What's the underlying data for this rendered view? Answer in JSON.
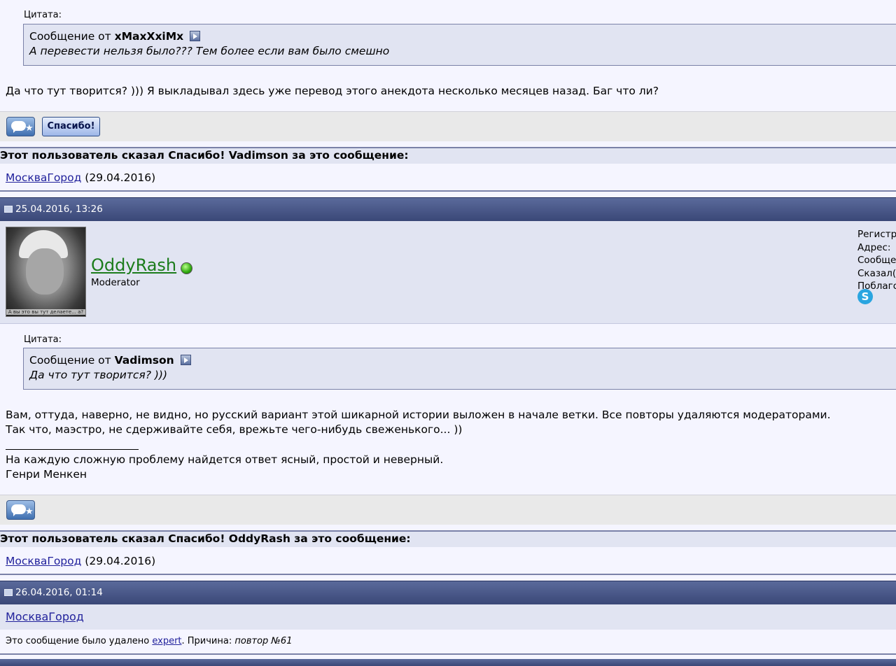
{
  "post1": {
    "quote_label": "Цитата:",
    "quote_prefix": "Сообщение от",
    "quote_author": "xMaxXxiMx",
    "quote_text": "А перевести нельзя было??? Тем более если вам было смешно",
    "body": "Да что тут творится? ))) Я выкладывал здесь уже перевод этого анекдота несколько месяцев назад. Баг что ли?",
    "thanks_button": "Спасибо!",
    "thanks_header": "Этот пользователь сказал Спасибо! Vadimson за это сообщение:",
    "thanks_user": "МоскваГород",
    "thanks_date": "(29.04.2016)"
  },
  "post2": {
    "datetime": "25.04.2016, 13:26",
    "username": "OddyRash",
    "user_title": "Moderator",
    "avatar_caption": "А вы это вы тут делаете... а?",
    "meta": [
      "Регистр",
      "Адрес:",
      "Сообще",
      "Сказал(",
      "Поблаго"
    ],
    "quote_label": "Цитата:",
    "quote_prefix": "Сообщение от",
    "quote_author": "Vadimson",
    "quote_text": "Да что тут творится? )))",
    "body_line1": "Вам, оттуда, наверно, не видно, но русский вариант этой шикарной истории выложен в начале ветки. Все повторы удаляются модераторами.",
    "body_line2": "Так что, маэстро, не сдерживайте себя, врежьте чего-нибудь свеженького... ))",
    "signature_line1": "На каждую сложную проблему найдется ответ ясный, простой и неверный.",
    "signature_line2": "Генри Менкен",
    "thanks_header": "Этот пользователь сказал Спасибо! OddyRash за это сообщение:",
    "thanks_user": "МоскваГород",
    "thanks_date": "(29.04.2016)"
  },
  "post3": {
    "datetime": "26.04.2016, 01:14",
    "username": "МоскваГород",
    "deleted_prefix": "Это сообщение было удалено",
    "deleted_by": "expert",
    "reason_label": ". Причина:",
    "reason": "повтор №61"
  },
  "colors": {
    "post_header": "#3a4777",
    "quote_bg": "#e1e4f2",
    "online_green": "#2ea80e",
    "username_green": "#1c7c1c"
  }
}
